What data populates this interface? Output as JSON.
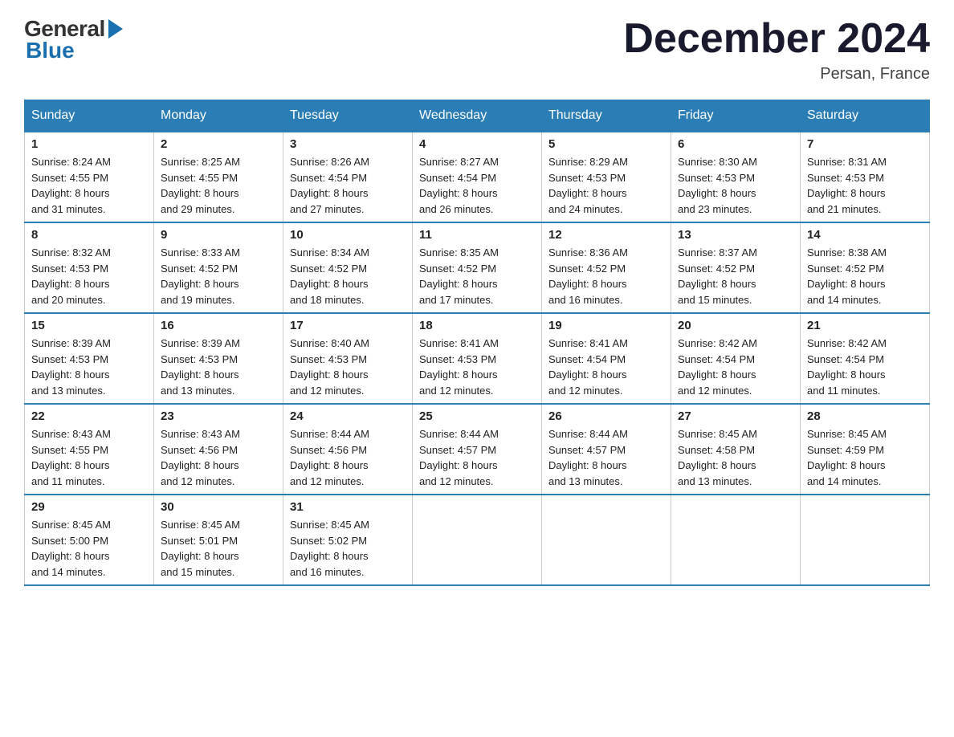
{
  "logo": {
    "general": "General",
    "blue": "Blue"
  },
  "title": "December 2024",
  "location": "Persan, France",
  "days_of_week": [
    "Sunday",
    "Monday",
    "Tuesday",
    "Wednesday",
    "Thursday",
    "Friday",
    "Saturday"
  ],
  "weeks": [
    [
      {
        "day": "1",
        "sunrise": "8:24 AM",
        "sunset": "4:55 PM",
        "daylight": "8 hours and 31 minutes."
      },
      {
        "day": "2",
        "sunrise": "8:25 AM",
        "sunset": "4:55 PM",
        "daylight": "8 hours and 29 minutes."
      },
      {
        "day": "3",
        "sunrise": "8:26 AM",
        "sunset": "4:54 PM",
        "daylight": "8 hours and 27 minutes."
      },
      {
        "day": "4",
        "sunrise": "8:27 AM",
        "sunset": "4:54 PM",
        "daylight": "8 hours and 26 minutes."
      },
      {
        "day": "5",
        "sunrise": "8:29 AM",
        "sunset": "4:53 PM",
        "daylight": "8 hours and 24 minutes."
      },
      {
        "day": "6",
        "sunrise": "8:30 AM",
        "sunset": "4:53 PM",
        "daylight": "8 hours and 23 minutes."
      },
      {
        "day": "7",
        "sunrise": "8:31 AM",
        "sunset": "4:53 PM",
        "daylight": "8 hours and 21 minutes."
      }
    ],
    [
      {
        "day": "8",
        "sunrise": "8:32 AM",
        "sunset": "4:53 PM",
        "daylight": "8 hours and 20 minutes."
      },
      {
        "day": "9",
        "sunrise": "8:33 AM",
        "sunset": "4:52 PM",
        "daylight": "8 hours and 19 minutes."
      },
      {
        "day": "10",
        "sunrise": "8:34 AM",
        "sunset": "4:52 PM",
        "daylight": "8 hours and 18 minutes."
      },
      {
        "day": "11",
        "sunrise": "8:35 AM",
        "sunset": "4:52 PM",
        "daylight": "8 hours and 17 minutes."
      },
      {
        "day": "12",
        "sunrise": "8:36 AM",
        "sunset": "4:52 PM",
        "daylight": "8 hours and 16 minutes."
      },
      {
        "day": "13",
        "sunrise": "8:37 AM",
        "sunset": "4:52 PM",
        "daylight": "8 hours and 15 minutes."
      },
      {
        "day": "14",
        "sunrise": "8:38 AM",
        "sunset": "4:52 PM",
        "daylight": "8 hours and 14 minutes."
      }
    ],
    [
      {
        "day": "15",
        "sunrise": "8:39 AM",
        "sunset": "4:53 PM",
        "daylight": "8 hours and 13 minutes."
      },
      {
        "day": "16",
        "sunrise": "8:39 AM",
        "sunset": "4:53 PM",
        "daylight": "8 hours and 13 minutes."
      },
      {
        "day": "17",
        "sunrise": "8:40 AM",
        "sunset": "4:53 PM",
        "daylight": "8 hours and 12 minutes."
      },
      {
        "day": "18",
        "sunrise": "8:41 AM",
        "sunset": "4:53 PM",
        "daylight": "8 hours and 12 minutes."
      },
      {
        "day": "19",
        "sunrise": "8:41 AM",
        "sunset": "4:54 PM",
        "daylight": "8 hours and 12 minutes."
      },
      {
        "day": "20",
        "sunrise": "8:42 AM",
        "sunset": "4:54 PM",
        "daylight": "8 hours and 12 minutes."
      },
      {
        "day": "21",
        "sunrise": "8:42 AM",
        "sunset": "4:54 PM",
        "daylight": "8 hours and 11 minutes."
      }
    ],
    [
      {
        "day": "22",
        "sunrise": "8:43 AM",
        "sunset": "4:55 PM",
        "daylight": "8 hours and 11 minutes."
      },
      {
        "day": "23",
        "sunrise": "8:43 AM",
        "sunset": "4:56 PM",
        "daylight": "8 hours and 12 minutes."
      },
      {
        "day": "24",
        "sunrise": "8:44 AM",
        "sunset": "4:56 PM",
        "daylight": "8 hours and 12 minutes."
      },
      {
        "day": "25",
        "sunrise": "8:44 AM",
        "sunset": "4:57 PM",
        "daylight": "8 hours and 12 minutes."
      },
      {
        "day": "26",
        "sunrise": "8:44 AM",
        "sunset": "4:57 PM",
        "daylight": "8 hours and 13 minutes."
      },
      {
        "day": "27",
        "sunrise": "8:45 AM",
        "sunset": "4:58 PM",
        "daylight": "8 hours and 13 minutes."
      },
      {
        "day": "28",
        "sunrise": "8:45 AM",
        "sunset": "4:59 PM",
        "daylight": "8 hours and 14 minutes."
      }
    ],
    [
      {
        "day": "29",
        "sunrise": "8:45 AM",
        "sunset": "5:00 PM",
        "daylight": "8 hours and 14 minutes."
      },
      {
        "day": "30",
        "sunrise": "8:45 AM",
        "sunset": "5:01 PM",
        "daylight": "8 hours and 15 minutes."
      },
      {
        "day": "31",
        "sunrise": "8:45 AM",
        "sunset": "5:02 PM",
        "daylight": "8 hours and 16 minutes."
      },
      null,
      null,
      null,
      null
    ]
  ],
  "labels": {
    "sunrise": "Sunrise:",
    "sunset": "Sunset:",
    "daylight": "Daylight:"
  }
}
